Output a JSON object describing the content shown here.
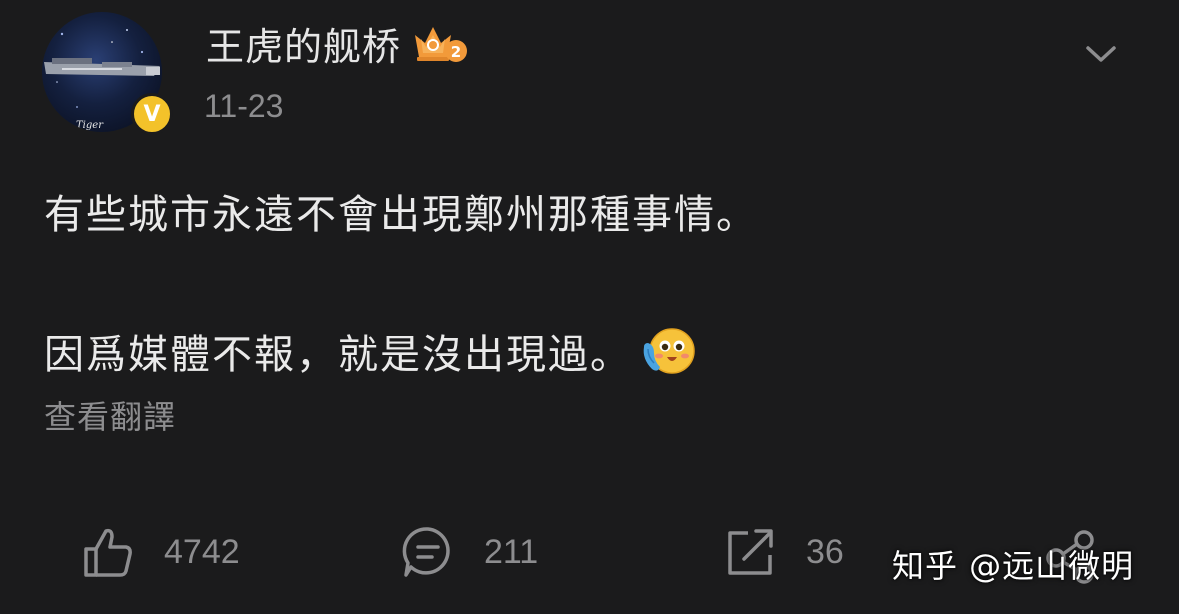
{
  "header": {
    "username": "王虎的舰桥",
    "level_badge": "2",
    "date": "11-23",
    "verified_mark": "V",
    "avatar_text": "Tiger"
  },
  "content": {
    "line1": "有些城市永遠不會出現鄭州那種事情。",
    "line2": "因爲媒體不報，就是沒出現過。",
    "emoji": "hugging-face-emoji",
    "translate_label": "查看翻譯"
  },
  "actions": {
    "like_count": "4742",
    "comment_count": "211",
    "share_count": "36"
  },
  "watermark": "知乎 @远山微明",
  "colors": {
    "background": "#1b1b1c",
    "text_primary": "#eaeaea",
    "text_secondary": "#8d8d8f",
    "verified": "#f3c22a",
    "badge_orange": "#f29a3a"
  }
}
